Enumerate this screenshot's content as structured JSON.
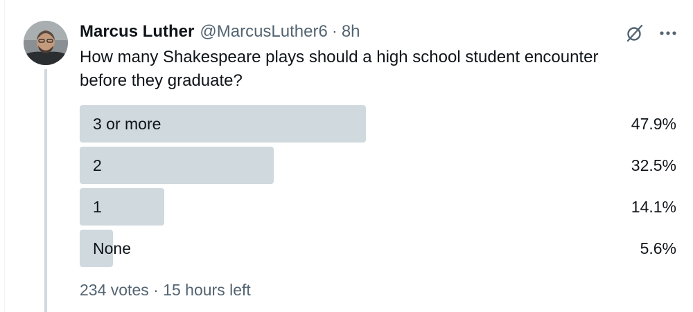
{
  "tweet": {
    "author_name": "Marcus Luther",
    "author_handle": "@MarcusLuther6",
    "separator": "·",
    "time": "8h",
    "text": "How many Shakespeare plays should a high school student encounter before they graduate?",
    "icons": [
      "grok-icon",
      "more-icon"
    ]
  },
  "poll": {
    "options": [
      {
        "label": "3 or more",
        "percent_text": "47.9%",
        "percent": 47.9
      },
      {
        "label": "2",
        "percent_text": "32.5%",
        "percent": 32.5
      },
      {
        "label": "1",
        "percent_text": "14.1%",
        "percent": 14.1
      },
      {
        "label": "None",
        "percent_text": "5.6%",
        "percent": 5.6
      }
    ],
    "votes": "234 votes",
    "separator": "·",
    "time_left": "15 hours left"
  },
  "colors": {
    "bar": "#cfd9de",
    "secondary_text": "#536471",
    "primary_text": "#0f1419"
  }
}
